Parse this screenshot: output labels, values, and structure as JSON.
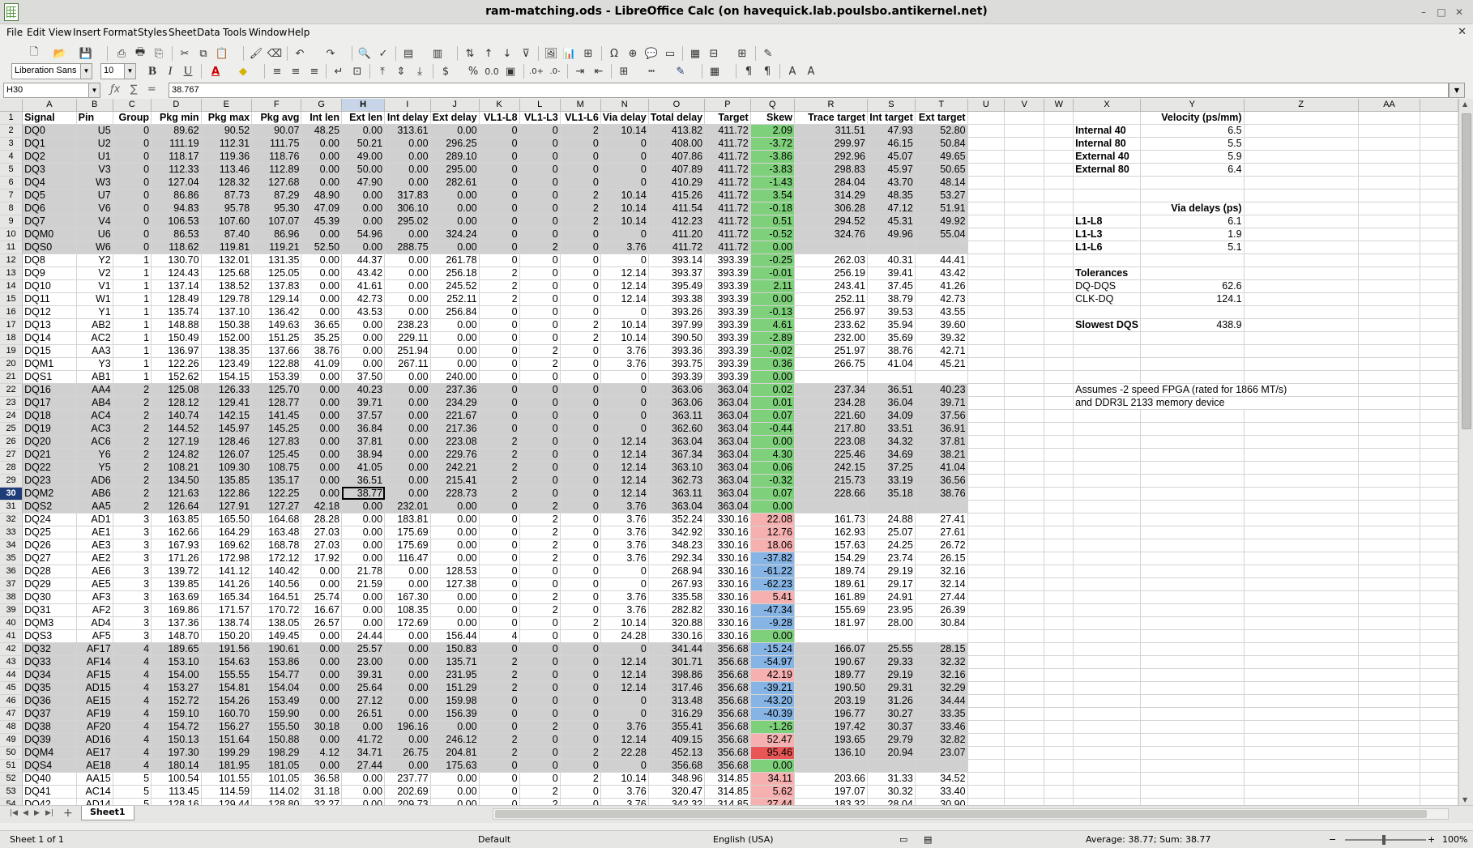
{
  "window": {
    "title": "ram-matching.ods - LibreOffice Calc (on havequick.lab.poulsbo.antikernel.net)",
    "minimize": "–",
    "maximize": "□",
    "close": "✕"
  },
  "menu": [
    "File",
    "Edit",
    "View",
    "Insert",
    "Format",
    "Styles",
    "Sheet",
    "Data",
    "Tools",
    "Window",
    "Help"
  ],
  "format_toolbar": {
    "font_name": "Liberation Sans",
    "font_size": "10"
  },
  "formula_bar": {
    "cell_ref": "H30",
    "content": "38.767"
  },
  "column_headers": [
    "A",
    "B",
    "C",
    "D",
    "E",
    "F",
    "G",
    "H",
    "I",
    "J",
    "K",
    "L",
    "M",
    "N",
    "O",
    "P",
    "Q",
    "R",
    "S",
    "T",
    "U",
    "V",
    "W",
    "X",
    "Y",
    "Z",
    "AA"
  ],
  "table_header": [
    "Signal",
    "Pin",
    "Group",
    "Pkg min",
    "Pkg max",
    "Pkg avg",
    "Int len",
    "Ext len",
    "Int delay",
    "Ext delay",
    "VL1-L8",
    "VL1-L3",
    "VL1-L6",
    "Via delay",
    "Total delay",
    "Target",
    "Skew",
    "Trace target",
    "Int target",
    "Ext target"
  ],
  "rows": [
    [
      "DQ0",
      "U5",
      "0",
      "89.62",
      "90.52",
      "90.07",
      "48.25",
      "0.00",
      "313.61",
      "0.00",
      "0",
      "0",
      "2",
      "10.14",
      "413.82",
      "411.72",
      "2.09",
      "311.51",
      "47.93",
      "52.80"
    ],
    [
      "DQ1",
      "U2",
      "0",
      "111.19",
      "112.31",
      "111.75",
      "0.00",
      "50.21",
      "0.00",
      "296.25",
      "0",
      "0",
      "0",
      "0",
      "408.00",
      "411.72",
      "-3.72",
      "299.97",
      "46.15",
      "50.84"
    ],
    [
      "DQ2",
      "U1",
      "0",
      "118.17",
      "119.36",
      "118.76",
      "0.00",
      "49.00",
      "0.00",
      "289.10",
      "0",
      "0",
      "0",
      "0",
      "407.86",
      "411.72",
      "-3.86",
      "292.96",
      "45.07",
      "49.65"
    ],
    [
      "DQ3",
      "V3",
      "0",
      "112.33",
      "113.46",
      "112.89",
      "0.00",
      "50.00",
      "0.00",
      "295.00",
      "0",
      "0",
      "0",
      "0",
      "407.89",
      "411.72",
      "-3.83",
      "298.83",
      "45.97",
      "50.65"
    ],
    [
      "DQ4",
      "W3",
      "0",
      "127.04",
      "128.32",
      "127.68",
      "0.00",
      "47.90",
      "0.00",
      "282.61",
      "0",
      "0",
      "0",
      "0",
      "410.29",
      "411.72",
      "-1.43",
      "284.04",
      "43.70",
      "48.14"
    ],
    [
      "DQ5",
      "U7",
      "0",
      "86.86",
      "87.73",
      "87.29",
      "48.90",
      "0.00",
      "317.83",
      "0.00",
      "0",
      "0",
      "2",
      "10.14",
      "415.26",
      "411.72",
      "3.54",
      "314.29",
      "48.35",
      "53.27"
    ],
    [
      "DQ6",
      "V6",
      "0",
      "94.83",
      "95.78",
      "95.30",
      "47.09",
      "0.00",
      "306.10",
      "0.00",
      "0",
      "0",
      "2",
      "10.14",
      "411.54",
      "411.72",
      "-0.18",
      "306.28",
      "47.12",
      "51.91"
    ],
    [
      "DQ7",
      "V4",
      "0",
      "106.53",
      "107.60",
      "107.07",
      "45.39",
      "0.00",
      "295.02",
      "0.00",
      "0",
      "0",
      "2",
      "10.14",
      "412.23",
      "411.72",
      "0.51",
      "294.52",
      "45.31",
      "49.92"
    ],
    [
      "DQM0",
      "U6",
      "0",
      "86.53",
      "87.40",
      "86.96",
      "0.00",
      "54.96",
      "0.00",
      "324.24",
      "0",
      "0",
      "0",
      "0",
      "411.20",
      "411.72",
      "-0.52",
      "324.76",
      "49.96",
      "55.04"
    ],
    [
      "DQS0",
      "W6",
      "0",
      "118.62",
      "119.81",
      "119.21",
      "52.50",
      "0.00",
      "288.75",
      "0.00",
      "0",
      "2",
      "0",
      "3.76",
      "411.72",
      "411.72",
      "0.00",
      "",
      "",
      ""
    ],
    [
      "DQ8",
      "Y2",
      "1",
      "130.70",
      "132.01",
      "131.35",
      "0.00",
      "44.37",
      "0.00",
      "261.78",
      "0",
      "0",
      "0",
      "0",
      "393.14",
      "393.39",
      "-0.25",
      "262.03",
      "40.31",
      "44.41"
    ],
    [
      "DQ9",
      "V2",
      "1",
      "124.43",
      "125.68",
      "125.05",
      "0.00",
      "43.42",
      "0.00",
      "256.18",
      "2",
      "0",
      "0",
      "12.14",
      "393.37",
      "393.39",
      "-0.01",
      "256.19",
      "39.41",
      "43.42"
    ],
    [
      "DQ10",
      "V1",
      "1",
      "137.14",
      "138.52",
      "137.83",
      "0.00",
      "41.61",
      "0.00",
      "245.52",
      "2",
      "0",
      "0",
      "12.14",
      "395.49",
      "393.39",
      "2.11",
      "243.41",
      "37.45",
      "41.26"
    ],
    [
      "DQ11",
      "W1",
      "1",
      "128.49",
      "129.78",
      "129.14",
      "0.00",
      "42.73",
      "0.00",
      "252.11",
      "2",
      "0",
      "0",
      "12.14",
      "393.38",
      "393.39",
      "0.00",
      "252.11",
      "38.79",
      "42.73"
    ],
    [
      "DQ12",
      "Y1",
      "1",
      "135.74",
      "137.10",
      "136.42",
      "0.00",
      "43.53",
      "0.00",
      "256.84",
      "0",
      "0",
      "0",
      "0",
      "393.26",
      "393.39",
      "-0.13",
      "256.97",
      "39.53",
      "43.55"
    ],
    [
      "DQ13",
      "AB2",
      "1",
      "148.88",
      "150.38",
      "149.63",
      "36.65",
      "0.00",
      "238.23",
      "0.00",
      "0",
      "0",
      "2",
      "10.14",
      "397.99",
      "393.39",
      "4.61",
      "233.62",
      "35.94",
      "39.60"
    ],
    [
      "DQ14",
      "AC2",
      "1",
      "150.49",
      "152.00",
      "151.25",
      "35.25",
      "0.00",
      "229.11",
      "0.00",
      "0",
      "0",
      "2",
      "10.14",
      "390.50",
      "393.39",
      "-2.89",
      "232.00",
      "35.69",
      "39.32"
    ],
    [
      "DQ15",
      "AA3",
      "1",
      "136.97",
      "138.35",
      "137.66",
      "38.76",
      "0.00",
      "251.94",
      "0.00",
      "0",
      "2",
      "0",
      "3.76",
      "393.36",
      "393.39",
      "-0.02",
      "251.97",
      "38.76",
      "42.71"
    ],
    [
      "DQM1",
      "Y3",
      "1",
      "122.26",
      "123.49",
      "122.88",
      "41.09",
      "0.00",
      "267.11",
      "0.00",
      "0",
      "2",
      "0",
      "3.76",
      "393.75",
      "393.39",
      "0.36",
      "266.75",
      "41.04",
      "45.21"
    ],
    [
      "DQS1",
      "AB1",
      "1",
      "152.62",
      "154.15",
      "153.39",
      "0.00",
      "37.50",
      "0.00",
      "240.00",
      "0",
      "0",
      "0",
      "0",
      "393.39",
      "393.39",
      "0.00",
      "",
      "",
      ""
    ],
    [
      "DQ16",
      "AA4",
      "2",
      "125.08",
      "126.33",
      "125.70",
      "0.00",
      "40.23",
      "0.00",
      "237.36",
      "0",
      "0",
      "0",
      "0",
      "363.06",
      "363.04",
      "0.02",
      "237.34",
      "36.51",
      "40.23"
    ],
    [
      "DQ17",
      "AB4",
      "2",
      "128.12",
      "129.41",
      "128.77",
      "0.00",
      "39.71",
      "0.00",
      "234.29",
      "0",
      "0",
      "0",
      "0",
      "363.06",
      "363.04",
      "0.01",
      "234.28",
      "36.04",
      "39.71"
    ],
    [
      "DQ18",
      "AC4",
      "2",
      "140.74",
      "142.15",
      "141.45",
      "0.00",
      "37.57",
      "0.00",
      "221.67",
      "0",
      "0",
      "0",
      "0",
      "363.11",
      "363.04",
      "0.07",
      "221.60",
      "34.09",
      "37.56"
    ],
    [
      "DQ19",
      "AC3",
      "2",
      "144.52",
      "145.97",
      "145.25",
      "0.00",
      "36.84",
      "0.00",
      "217.36",
      "0",
      "0",
      "0",
      "0",
      "362.60",
      "363.04",
      "-0.44",
      "217.80",
      "33.51",
      "36.91"
    ],
    [
      "DQ20",
      "AC6",
      "2",
      "127.19",
      "128.46",
      "127.83",
      "0.00",
      "37.81",
      "0.00",
      "223.08",
      "2",
      "0",
      "0",
      "12.14",
      "363.04",
      "363.04",
      "0.00",
      "223.08",
      "34.32",
      "37.81"
    ],
    [
      "DQ21",
      "Y6",
      "2",
      "124.82",
      "126.07",
      "125.45",
      "0.00",
      "38.94",
      "0.00",
      "229.76",
      "2",
      "0",
      "0",
      "12.14",
      "367.34",
      "363.04",
      "4.30",
      "225.46",
      "34.69",
      "38.21"
    ],
    [
      "DQ22",
      "Y5",
      "2",
      "108.21",
      "109.30",
      "108.75",
      "0.00",
      "41.05",
      "0.00",
      "242.21",
      "2",
      "0",
      "0",
      "12.14",
      "363.10",
      "363.04",
      "0.06",
      "242.15",
      "37.25",
      "41.04"
    ],
    [
      "DQ23",
      "AD6",
      "2",
      "134.50",
      "135.85",
      "135.17",
      "0.00",
      "36.51",
      "0.00",
      "215.41",
      "2",
      "0",
      "0",
      "12.14",
      "362.73",
      "363.04",
      "-0.32",
      "215.73",
      "33.19",
      "36.56"
    ],
    [
      "DQM2",
      "AB6",
      "2",
      "121.63",
      "122.86",
      "122.25",
      "0.00",
      "38.77",
      "0.00",
      "228.73",
      "2",
      "0",
      "0",
      "12.14",
      "363.11",
      "363.04",
      "0.07",
      "228.66",
      "35.18",
      "38.76"
    ],
    [
      "DQS2",
      "AA5",
      "2",
      "126.64",
      "127.91",
      "127.27",
      "42.18",
      "0.00",
      "232.01",
      "0.00",
      "0",
      "2",
      "0",
      "3.76",
      "363.04",
      "363.04",
      "0.00",
      "",
      "",
      ""
    ],
    [
      "DQ24",
      "AD1",
      "3",
      "163.85",
      "165.50",
      "164.68",
      "28.28",
      "0.00",
      "183.81",
      "0.00",
      "0",
      "2",
      "0",
      "3.76",
      "352.24",
      "330.16",
      "22.08",
      "161.73",
      "24.88",
      "27.41"
    ],
    [
      "DQ25",
      "AE1",
      "3",
      "162.66",
      "164.29",
      "163.48",
      "27.03",
      "0.00",
      "175.69",
      "0.00",
      "0",
      "2",
      "0",
      "3.76",
      "342.92",
      "330.16",
      "12.76",
      "162.93",
      "25.07",
      "27.61"
    ],
    [
      "DQ26",
      "AE3",
      "3",
      "167.93",
      "169.62",
      "168.78",
      "27.03",
      "0.00",
      "175.69",
      "0.00",
      "0",
      "2",
      "0",
      "3.76",
      "348.23",
      "330.16",
      "18.06",
      "157.63",
      "24.25",
      "26.72"
    ],
    [
      "DQ27",
      "AE2",
      "3",
      "171.26",
      "172.98",
      "172.12",
      "17.92",
      "0.00",
      "116.47",
      "0.00",
      "0",
      "2",
      "0",
      "3.76",
      "292.34",
      "330.16",
      "-37.82",
      "154.29",
      "23.74",
      "26.15"
    ],
    [
      "DQ28",
      "AE6",
      "3",
      "139.72",
      "141.12",
      "140.42",
      "0.00",
      "21.78",
      "0.00",
      "128.53",
      "0",
      "0",
      "0",
      "0",
      "268.94",
      "330.16",
      "-61.22",
      "189.74",
      "29.19",
      "32.16"
    ],
    [
      "DQ29",
      "AE5",
      "3",
      "139.85",
      "141.26",
      "140.56",
      "0.00",
      "21.59",
      "0.00",
      "127.38",
      "0",
      "0",
      "0",
      "0",
      "267.93",
      "330.16",
      "-62.23",
      "189.61",
      "29.17",
      "32.14"
    ],
    [
      "DQ30",
      "AF3",
      "3",
      "163.69",
      "165.34",
      "164.51",
      "25.74",
      "0.00",
      "167.30",
      "0.00",
      "0",
      "2",
      "0",
      "3.76",
      "335.58",
      "330.16",
      "5.41",
      "161.89",
      "24.91",
      "27.44"
    ],
    [
      "DQ31",
      "AF2",
      "3",
      "169.86",
      "171.57",
      "170.72",
      "16.67",
      "0.00",
      "108.35",
      "0.00",
      "0",
      "2",
      "0",
      "3.76",
      "282.82",
      "330.16",
      "-47.34",
      "155.69",
      "23.95",
      "26.39"
    ],
    [
      "DQM3",
      "AD4",
      "3",
      "137.36",
      "138.74",
      "138.05",
      "26.57",
      "0.00",
      "172.69",
      "0.00",
      "0",
      "0",
      "2",
      "10.14",
      "320.88",
      "330.16",
      "-9.28",
      "181.97",
      "28.00",
      "30.84"
    ],
    [
      "DQS3",
      "AF5",
      "3",
      "148.70",
      "150.20",
      "149.45",
      "0.00",
      "24.44",
      "0.00",
      "156.44",
      "4",
      "0",
      "0",
      "24.28",
      "330.16",
      "330.16",
      "0.00",
      "",
      "",
      ""
    ],
    [
      "DQ32",
      "AF17",
      "4",
      "189.65",
      "191.56",
      "190.61",
      "0.00",
      "25.57",
      "0.00",
      "150.83",
      "0",
      "0",
      "0",
      "0",
      "341.44",
      "356.68",
      "-15.24",
      "166.07",
      "25.55",
      "28.15"
    ],
    [
      "DQ33",
      "AF14",
      "4",
      "153.10",
      "154.63",
      "153.86",
      "0.00",
      "23.00",
      "0.00",
      "135.71",
      "2",
      "0",
      "0",
      "12.14",
      "301.71",
      "356.68",
      "-54.97",
      "190.67",
      "29.33",
      "32.32"
    ],
    [
      "DQ34",
      "AF15",
      "4",
      "154.00",
      "155.55",
      "154.77",
      "0.00",
      "39.31",
      "0.00",
      "231.95",
      "2",
      "0",
      "0",
      "12.14",
      "398.86",
      "356.68",
      "42.19",
      "189.77",
      "29.19",
      "32.16"
    ],
    [
      "DQ35",
      "AD15",
      "4",
      "153.27",
      "154.81",
      "154.04",
      "0.00",
      "25.64",
      "0.00",
      "151.29",
      "2",
      "0",
      "0",
      "12.14",
      "317.46",
      "356.68",
      "-39.21",
      "190.50",
      "29.31",
      "32.29"
    ],
    [
      "DQ36",
      "AE15",
      "4",
      "152.72",
      "154.26",
      "153.49",
      "0.00",
      "27.12",
      "0.00",
      "159.98",
      "0",
      "0",
      "0",
      "0",
      "313.48",
      "356.68",
      "-43.20",
      "203.19",
      "31.26",
      "34.44"
    ],
    [
      "DQ37",
      "AF19",
      "4",
      "159.10",
      "160.70",
      "159.90",
      "0.00",
      "26.51",
      "0.00",
      "156.39",
      "0",
      "0",
      "0",
      "0",
      "316.29",
      "356.68",
      "-40.39",
      "196.77",
      "30.27",
      "33.35"
    ],
    [
      "DQ38",
      "AF20",
      "4",
      "154.72",
      "156.27",
      "155.50",
      "30.18",
      "0.00",
      "196.16",
      "0.00",
      "0",
      "2",
      "0",
      "3.76",
      "355.41",
      "356.68",
      "-1.26",
      "197.42",
      "30.37",
      "33.46"
    ],
    [
      "DQ39",
      "AD16",
      "4",
      "150.13",
      "151.64",
      "150.88",
      "0.00",
      "41.72",
      "0.00",
      "246.12",
      "2",
      "0",
      "0",
      "12.14",
      "409.15",
      "356.68",
      "52.47",
      "193.65",
      "29.79",
      "32.82"
    ],
    [
      "DQM4",
      "AE17",
      "4",
      "197.30",
      "199.29",
      "198.29",
      "4.12",
      "34.71",
      "26.75",
      "204.81",
      "2",
      "0",
      "2",
      "22.28",
      "452.13",
      "356.68",
      "95.46",
      "136.10",
      "20.94",
      "23.07"
    ],
    [
      "DQS4",
      "AE18",
      "4",
      "180.14",
      "181.95",
      "181.05",
      "0.00",
      "27.44",
      "0.00",
      "175.63",
      "0",
      "0",
      "0",
      "0",
      "356.68",
      "356.68",
      "0.00",
      "",
      "",
      ""
    ],
    [
      "DQ40",
      "AA15",
      "5",
      "100.54",
      "101.55",
      "101.05",
      "36.58",
      "0.00",
      "237.77",
      "0.00",
      "0",
      "0",
      "2",
      "10.14",
      "348.96",
      "314.85",
      "34.11",
      "203.66",
      "31.33",
      "34.52"
    ],
    [
      "DQ41",
      "AC14",
      "5",
      "113.45",
      "114.59",
      "114.02",
      "31.18",
      "0.00",
      "202.69",
      "0.00",
      "0",
      "2",
      "0",
      "3.76",
      "320.47",
      "314.85",
      "5.62",
      "197.07",
      "30.32",
      "33.40"
    ],
    [
      "DQ42",
      "AD14",
      "5",
      "128.16",
      "129.44",
      "128.80",
      "32.27",
      "0.00",
      "209.73",
      "0.00",
      "0",
      "2",
      "0",
      "3.76",
      "342.32",
      "314.85",
      "27.44",
      "183.32",
      "28.04",
      "30.90"
    ]
  ],
  "side_panel": {
    "velocity_title": "Velocity (ps/mm)",
    "velocity": [
      [
        "Internal 40",
        "6.5"
      ],
      [
        "Internal 80",
        "5.5"
      ],
      [
        "External 40",
        "5.9"
      ],
      [
        "External 80",
        "6.4"
      ]
    ],
    "via_title": "Via delays (ps)",
    "via": [
      [
        "L1-L8",
        "6.1"
      ],
      [
        "L1-L3",
        "1.9"
      ],
      [
        "L1-L6",
        "5.1"
      ]
    ],
    "tol_title": "Tolerances",
    "tolerances": [
      [
        "DQ-DQS",
        "62.6"
      ],
      [
        "CLK-DQ",
        "124.1"
      ]
    ],
    "slowest_label": "Slowest DQS",
    "slowest_value": "438.9",
    "note1": "Assumes -2 speed FPGA (rated for 1866 MT/s)",
    "note2": "and DDR3L 2133 memory device"
  },
  "tabs": {
    "sheet_name": "Sheet1"
  },
  "status": {
    "sheet_info": "Sheet 1 of 1",
    "page_style": "Default",
    "language": "English (USA)",
    "selection_stats": "Average: 38.77; Sum: 38.77",
    "zoom": "100%"
  }
}
